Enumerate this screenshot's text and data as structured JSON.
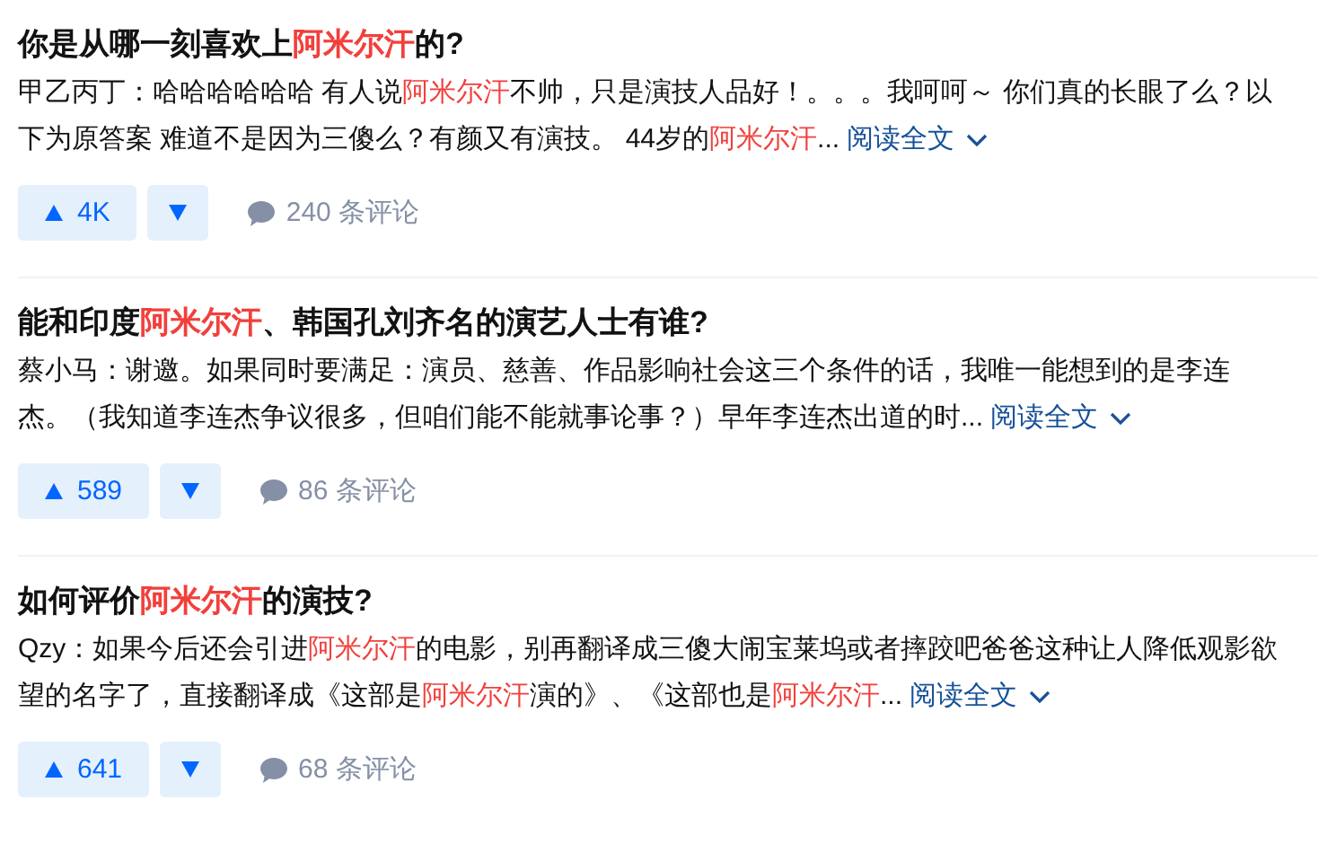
{
  "items": [
    {
      "title": [
        {
          "text": "你是从哪一刻喜欢上",
          "highlight": false
        },
        {
          "text": "阿米尔汗",
          "highlight": true
        },
        {
          "text": "的?",
          "highlight": false
        }
      ],
      "excerpt": [
        {
          "text": "甲乙丙丁：哈哈哈哈哈哈 有人说",
          "highlight": false
        },
        {
          "text": "阿米尔汗",
          "highlight": true
        },
        {
          "text": "不帅，只是演技人品好！。。。我呵呵～ 你们真的长眼了么？以下为原答案 难道不是因为三傻么？有颜又有演技。 44岁的",
          "highlight": false
        },
        {
          "text": "阿米尔汗",
          "highlight": true
        },
        {
          "text": "...",
          "highlight": false
        }
      ],
      "read_more": "阅读全文",
      "upvotes": "4K",
      "comments": "240 条评论"
    },
    {
      "title": [
        {
          "text": "能和印度",
          "highlight": false
        },
        {
          "text": "阿米尔汗",
          "highlight": true
        },
        {
          "text": "、韩国孔刘齐名的演艺人士有谁?",
          "highlight": false
        }
      ],
      "excerpt": [
        {
          "text": "蔡小马：谢邀。如果同时要满足：演员、慈善、作品影响社会这三个条件的话，我唯一能想到的是李连杰。（我知道李连杰争议很多，但咱们能不能就事论事？）早年李连杰出道的时...",
          "highlight": false
        }
      ],
      "read_more": "阅读全文",
      "upvotes": "589",
      "comments": "86 条评论"
    },
    {
      "title": [
        {
          "text": "如何评价",
          "highlight": false
        },
        {
          "text": "阿米尔汗",
          "highlight": true
        },
        {
          "text": "的演技?",
          "highlight": false
        }
      ],
      "excerpt": [
        {
          "text": "Qzy：如果今后还会引进",
          "highlight": false
        },
        {
          "text": "阿米尔汗",
          "highlight": true
        },
        {
          "text": "的电影，别再翻译成三傻大闹宝莱坞或者摔跤吧爸爸这种让人降低观影欲望的名字了，直接翻译成《这部是",
          "highlight": false
        },
        {
          "text": "阿米尔汗",
          "highlight": true
        },
        {
          "text": "演的》、《这部也是",
          "highlight": false
        },
        {
          "text": "阿米尔汗",
          "highlight": true
        },
        {
          "text": "...",
          "highlight": false
        }
      ],
      "read_more": "阅读全文",
      "upvotes": "641",
      "comments": "68 条评论"
    }
  ]
}
